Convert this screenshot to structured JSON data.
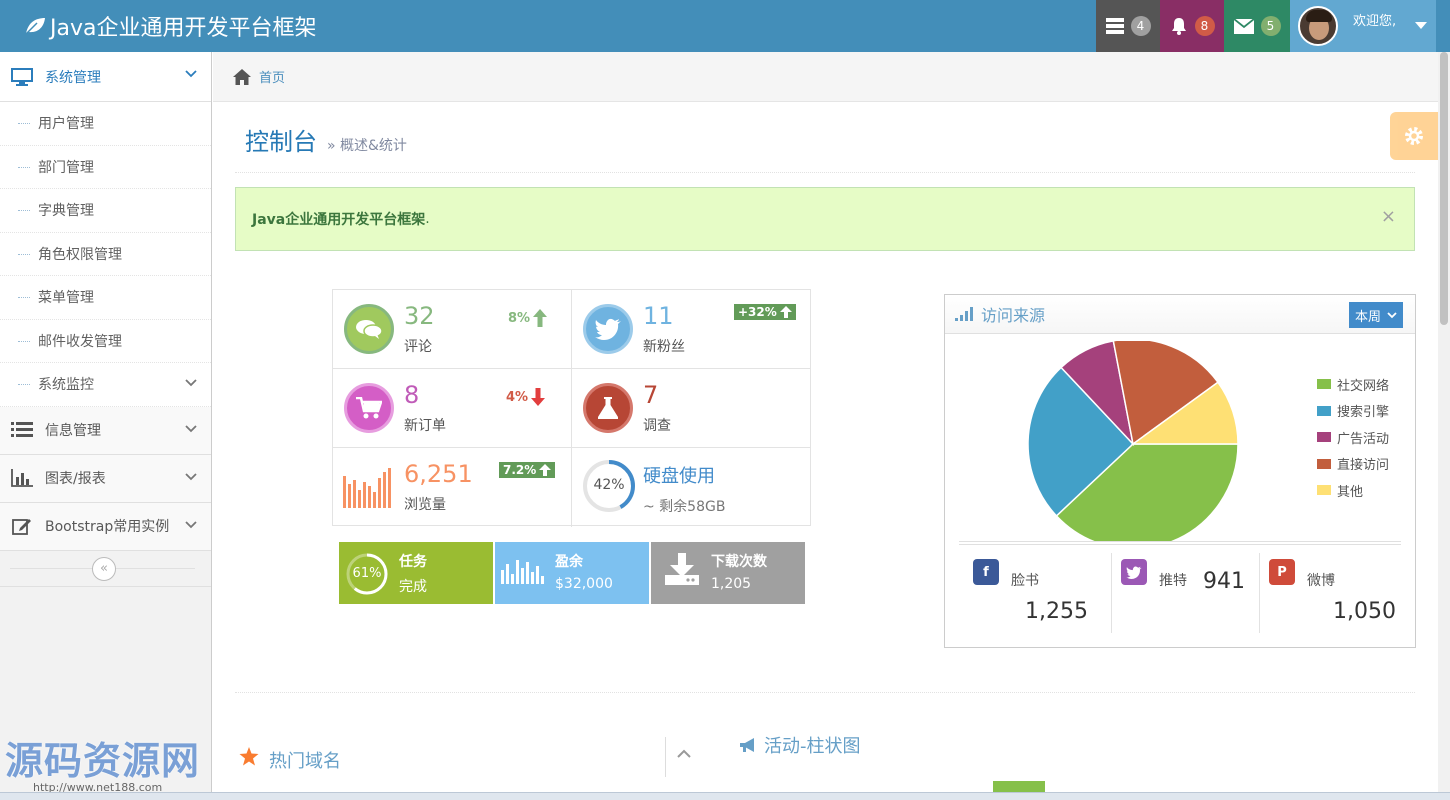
{
  "navbar": {
    "brand": "Java企业通用开发平台框架",
    "tasks_badge": "4",
    "notif_badge": "8",
    "mail_badge": "5",
    "welcome": "欢迎您,"
  },
  "sidebar": {
    "system": "系统管理",
    "sub_items": [
      "用户管理",
      "部门管理",
      "字典管理",
      "角色权限管理",
      "菜单管理",
      "邮件收发管理",
      "系统监控"
    ],
    "info": "信息管理",
    "charts": "图表/报表",
    "bootstrap": "Bootstrap常用实例",
    "collapse": "«"
  },
  "breadcrumb": {
    "home": "首页"
  },
  "page": {
    "title": "控制台",
    "subtitle": "» 概述&统计"
  },
  "alert": {
    "text": "Java企业通用开发平台框架",
    "dot": ".",
    "close": "×"
  },
  "stats": {
    "comments": {
      "num": "32",
      "label": "评论",
      "change": "8%"
    },
    "followers": {
      "num": "11",
      "label": "新粉丝",
      "change": "+32%"
    },
    "orders": {
      "num": "8",
      "label": "新订单",
      "change": "4%"
    },
    "surveys": {
      "num": "7",
      "label": "调查"
    },
    "pageviews": {
      "num": "6,251",
      "label": "浏览量",
      "change": "7.2%"
    },
    "disk": {
      "label": "硬盘使用",
      "remaining": "~ 剩余58GB",
      "percent": "42%",
      "value": 42
    }
  },
  "tiles": {
    "task": {
      "percent": "61%",
      "title": "任务",
      "sub": "完成",
      "value": 61
    },
    "balance": {
      "title": "盈余",
      "sub": "$32,000"
    },
    "downloads": {
      "title": "下载次数",
      "sub": "1,205"
    }
  },
  "traffic": {
    "title": "访问来源",
    "range": "本周",
    "facebook": {
      "name": "脸书",
      "count": "1,255"
    },
    "twitter": {
      "name": "推特",
      "count": "941"
    },
    "pinterest": {
      "name": "微博",
      "count": "1,050"
    }
  },
  "chart_data": {
    "type": "pie",
    "categories": [
      "社交网络",
      "搜索引擎",
      "广告活动",
      "直接访问",
      "其他"
    ],
    "values": [
      38,
      25,
      9,
      18,
      10
    ],
    "colors": [
      "#86c04a",
      "#42a0c8",
      "#a5417c",
      "#c25e3d",
      "#fee074"
    ]
  },
  "domains": {
    "title": "热门域名"
  },
  "activity": {
    "title": "活动-柱状图"
  },
  "watermark": {
    "text": "源码资源网",
    "url": "http://www.net188.com"
  }
}
